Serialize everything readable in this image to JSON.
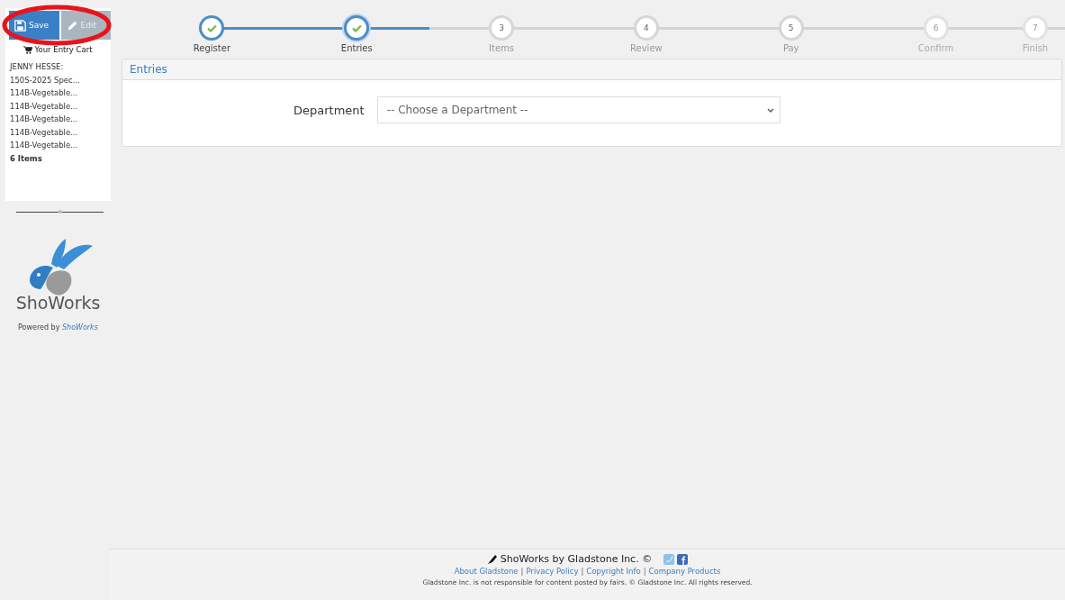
{
  "sidebar": {
    "buttons": [
      {
        "label": "Save",
        "kind": "save",
        "disabled": false
      },
      {
        "label": "Edit",
        "kind": "edit",
        "disabled": true
      }
    ],
    "cart_title": "Your Entry Cart",
    "cart_items": [
      "JENNY HESSE:",
      "150S-2025 Spec...",
      "114B-Vegetable...",
      "114B-Vegetable...",
      "114B-Vegetable...",
      "114B-Vegetable...",
      "114B-Vegetable..."
    ],
    "cart_count": "6 Items",
    "logo_text": "ShoWorks",
    "powered_by": "Powered by",
    "powered_link": "ShoWorks"
  },
  "steps": [
    {
      "label": "Register",
      "done": true,
      "disabled": false,
      "selected": false
    },
    {
      "label": "Entries",
      "done": true,
      "disabled": false,
      "selected": true
    },
    {
      "number": "3",
      "label": "Items",
      "done": false,
      "disabled": false,
      "selected": false
    },
    {
      "number": "4",
      "label": "Review",
      "done": false,
      "disabled": false,
      "selected": false
    },
    {
      "number": "5",
      "label": "Pay",
      "done": false,
      "disabled": false,
      "selected": false
    },
    {
      "number": "6",
      "label": "Confirm",
      "done": false,
      "disabled": true,
      "selected": false
    },
    {
      "number": "7",
      "label": "Finish",
      "done": false,
      "disabled": true,
      "selected": false
    }
  ],
  "panel": {
    "title": "Entries",
    "field_label": "Department",
    "select_value": "-- Choose a Department --"
  },
  "footer": {
    "brand": "ShoWorks by Gladstone Inc. ©",
    "links": [
      "About Gladstone",
      "Privacy Policy",
      "Copyright Info",
      "Company Products"
    ],
    "separator": "|",
    "disclaimer": "Gladstone Inc. is not responsible for content posted by fairs. © Gladstone Inc. All rights reserved."
  }
}
